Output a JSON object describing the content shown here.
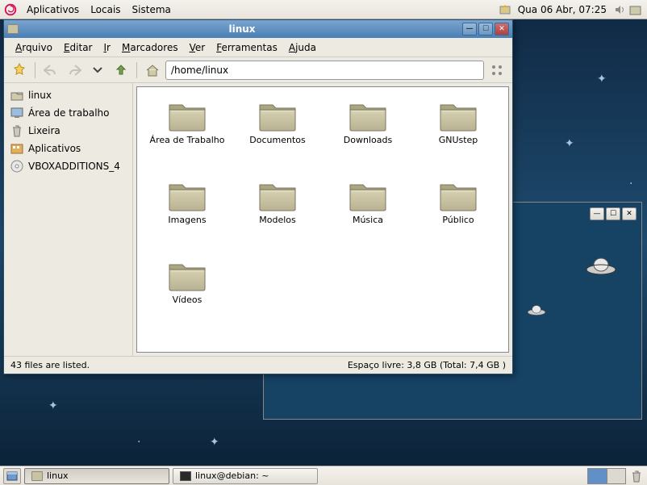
{
  "panel": {
    "menus": [
      "Aplicativos",
      "Locais",
      "Sistema"
    ],
    "clock": "Qua 06 Abr, 07:25"
  },
  "bg_window": {},
  "fm": {
    "title": "linux",
    "menubar": [
      {
        "label": "Arquivo",
        "ul": "A"
      },
      {
        "label": "Editar",
        "ul": "E"
      },
      {
        "label": "Ir",
        "ul": "I"
      },
      {
        "label": "Marcadores",
        "ul": "M"
      },
      {
        "label": "Ver",
        "ul": "V"
      },
      {
        "label": "Ferramentas",
        "ul": "F"
      },
      {
        "label": "Ajuda",
        "ul": "A"
      }
    ],
    "address": "/home/linux",
    "sidebar": [
      {
        "label": "linux",
        "icon": "home"
      },
      {
        "label": "Área de trabalho",
        "icon": "desktop"
      },
      {
        "label": "Lixeira",
        "icon": "trash"
      },
      {
        "label": "Aplicativos",
        "icon": "apps"
      },
      {
        "label": "VBOXADDITIONS_4",
        "icon": "disc"
      }
    ],
    "folders": [
      "Área de Trabalho",
      "Documentos",
      "Downloads",
      "GNUstep",
      "Imagens",
      "Modelos",
      "Música",
      "Público",
      "Vídeos"
    ],
    "status_left": "43 files are listed.",
    "status_right": "Espaço livre: 3,8 GB (Total: 7,4 GB )"
  },
  "taskbar": {
    "items": [
      {
        "label": "linux",
        "icon": "folder",
        "active": true
      },
      {
        "label": "linux@debian: ~",
        "icon": "terminal",
        "active": false
      }
    ]
  }
}
